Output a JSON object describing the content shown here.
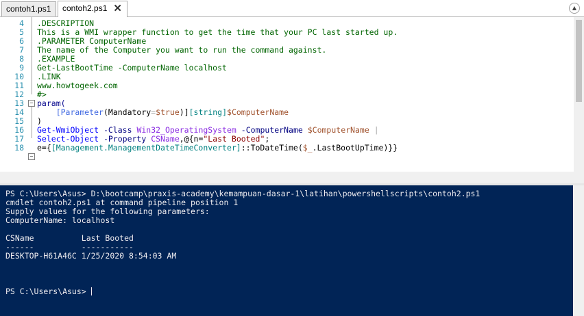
{
  "tabs": [
    {
      "label": "contoh1.ps1"
    },
    {
      "label": "contoh2.ps1",
      "close": "✕"
    }
  ],
  "editor": {
    "line_numbers": [
      "4",
      "5",
      "6",
      "7",
      "8",
      "9",
      "10",
      "11",
      "12",
      "13",
      "14",
      "15",
      "16",
      "17",
      "18"
    ],
    "lines": {
      "l4": ".DESCRIPTION",
      "l5": "This is a WMI wrapper function to get the time that your PC last started up.",
      "l6": ".PARAMETER ComputerName",
      "l7": "The name of the Computer you want to run the command against.",
      "l8": ".EXAMPLE",
      "l9": "Get-LastBootTime -ComputerName localhost",
      "l10": ".LINK",
      "l11": "www.howtogeek.com",
      "l12": "#>",
      "l13": "param(",
      "l14": {
        "attr": "[Parameter",
        "open": "(",
        "mand": "Mandatory",
        "eq": "=",
        "true": "$true",
        "close": ")]",
        "type": "[string]",
        "var": "$ComputerName"
      },
      "l15": ")",
      "l16": {
        "cmd": "Get-WmiObject",
        "p1": "-Class",
        "a1": "Win32_OperatingSystem",
        "p2": "-ComputerName",
        "v": "$ComputerName",
        "pipe": "|"
      },
      "l17": {
        "cmd": "Select-Object",
        "p1": "-Property",
        "a1": "CSName",
        "rest": ",@{n=",
        "str": "\"Last Booted\"",
        "semi": ";"
      },
      "l18": {
        "pre": "e={",
        "typ": "[Management.ManagementDateTimeConverter]",
        "mid": "::ToDateTime(",
        "var": "$_",
        "post": ".LastBootUpTime)}}"
      }
    }
  },
  "console": {
    "lines": [
      "PS C:\\Users\\Asus> D:\\bootcamp\\praxis-academy\\kemampuan-dasar-1\\latihan\\powershellscripts\\contoh2.ps1",
      "cmdlet contoh2.ps1 at command pipeline position 1",
      "Supply values for the following parameters:",
      "ComputerName: localhost",
      "",
      "CSName          Last Booted",
      "------          -----------",
      "DESKTOP-H61A46C 1/25/2020 8:54:03 AM"
    ],
    "prompt": "PS C:\\Users\\Asus> "
  }
}
